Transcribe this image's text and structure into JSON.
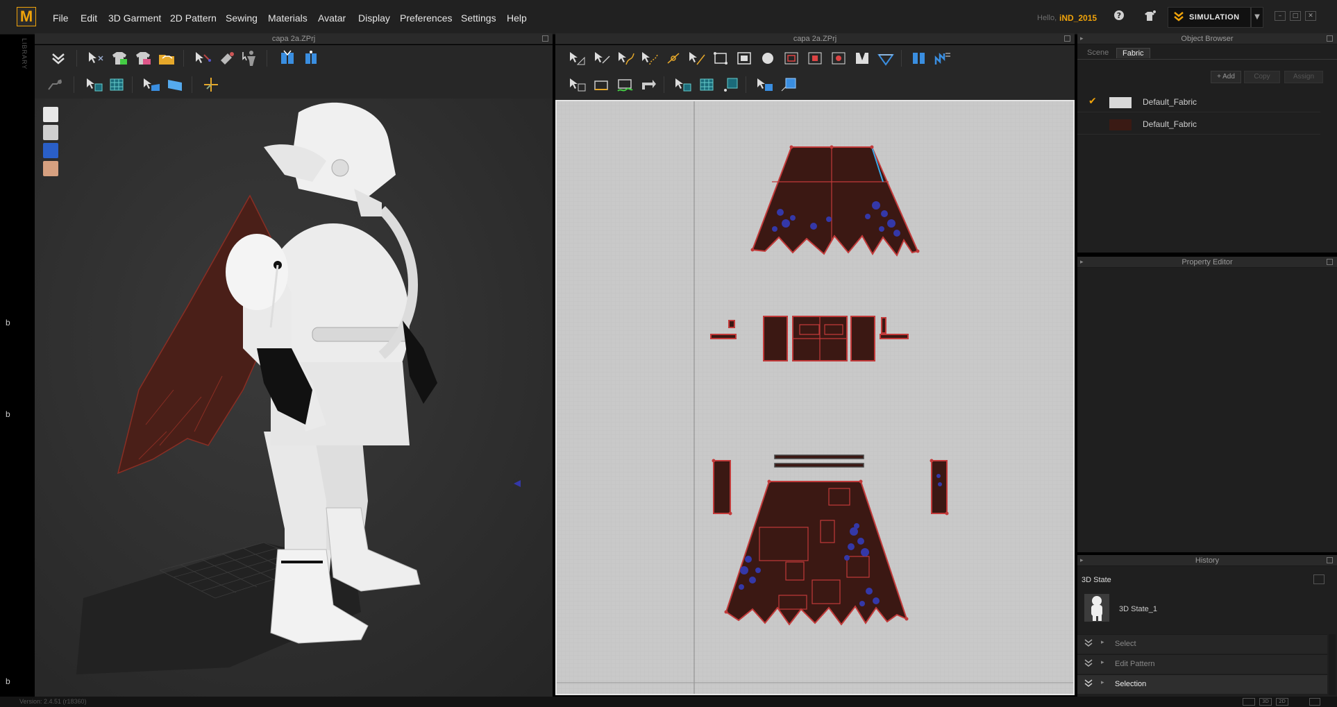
{
  "app": {
    "logo": "M"
  },
  "menu": [
    "File",
    "Edit",
    "3D Garment",
    "2D Pattern",
    "Sewing",
    "Materials",
    "Avatar",
    "Display",
    "Preferences",
    "Settings",
    "Help"
  ],
  "user": {
    "greeting": "Hello,",
    "name": "iND_2015"
  },
  "top_icons": [
    "help-icon",
    "avatar-settings-icon"
  ],
  "simulation": {
    "label": "SIMULATION",
    "accent": "#f0a30a"
  },
  "left_strip": {
    "library_label": "LIBRARY",
    "letters": [
      "b",
      "b",
      "b"
    ]
  },
  "panels": {
    "view3d_title": "capa 2a.ZPrj",
    "view2d_title": "capa 2a.ZPrj",
    "object_browser_title": "Object Browser",
    "property_editor_title": "Property Editor",
    "history_title": "History"
  },
  "object_browser": {
    "tabs": [
      {
        "label": "Scene",
        "active": false
      },
      {
        "label": "Fabric",
        "active": true
      }
    ],
    "actions": [
      "+ Add",
      "Copy",
      "Assign"
    ],
    "fabrics": [
      {
        "name": "Default_Fabric",
        "color": "#d8d8d8",
        "selected": true
      },
      {
        "name": "Default_Fabric",
        "color": "#3a1a14",
        "selected": false
      }
    ]
  },
  "history": {
    "state_header": "3D State",
    "state_item": "3D State_1",
    "items": [
      {
        "label": "Select",
        "active": false
      },
      {
        "label": "Edit Pattern",
        "active": false
      },
      {
        "label": "Selection",
        "active": true
      }
    ]
  },
  "status": {
    "version": "Version: 2.4.51     (r18360)"
  },
  "colors": {
    "accent": "#f0a30a",
    "pattern_fill": "#3b1813",
    "pattern_stroke": "#c23a3a",
    "pin_blue": "#3438a8",
    "grid_bg": "#c9c9c9"
  }
}
